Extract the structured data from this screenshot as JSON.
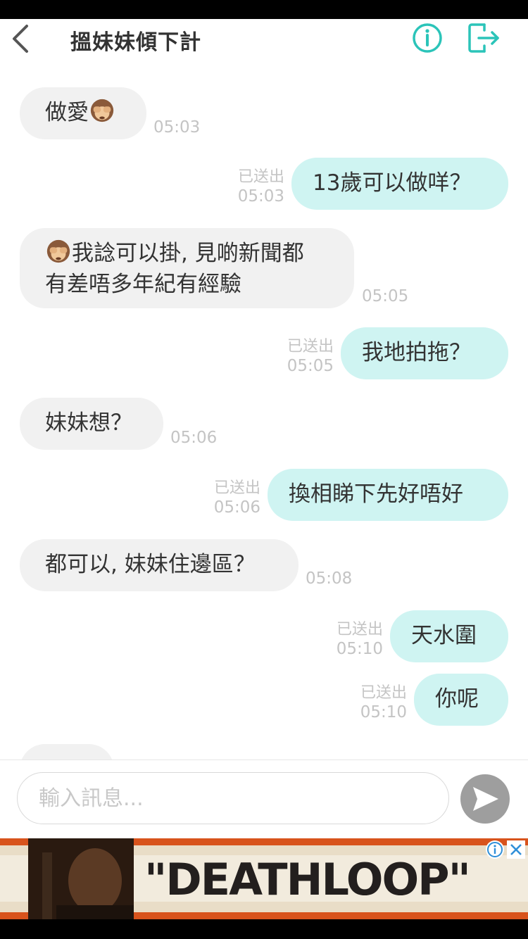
{
  "header": {
    "title": "搵妹妹傾下計",
    "back_icon": "chevron-left-icon",
    "info_icon": "info-icon",
    "exit_icon": "exit-icon",
    "accent_color": "#2bc4b9"
  },
  "messages": [
    {
      "dir": "in",
      "text": "做愛",
      "emoji": "see-no-evil-monkey",
      "time": "05:03"
    },
    {
      "dir": "out",
      "text": "13歲可以做咩？",
      "status": "已送出",
      "time": "05:03"
    },
    {
      "dir": "in",
      "line1": "我諗可以掛, 見啲新聞都",
      "line2": "有差唔多年紀有經驗",
      "emoji": "see-no-evil-monkey",
      "time": "05:05"
    },
    {
      "dir": "out",
      "text": "我地拍拖？",
      "status": "已送出",
      "time": "05:05"
    },
    {
      "dir": "in",
      "text": "妹妹想？",
      "time": "05:06"
    },
    {
      "dir": "out",
      "text": "換相睇下先好唔好",
      "status": "已送出",
      "time": "05:06"
    },
    {
      "dir": "in",
      "text": "都可以, 妹妹住邊區？",
      "time": "05:08"
    },
    {
      "dir": "out",
      "text": "天水圍",
      "status": "已送出",
      "time": "05:10"
    },
    {
      "dir": "out",
      "text": "你呢",
      "status": "已送出",
      "time": "05:10"
    },
    {
      "dir": "in",
      "text": "",
      "time": ""
    }
  ],
  "composer": {
    "placeholder": "輸入訊息...",
    "send_icon": "send-icon"
  },
  "ad": {
    "text": "\"DEATHLOOP\"",
    "info_icon": "ad-info-icon",
    "close_icon": "close-icon"
  },
  "colors": {
    "incoming_bubble": "#f1f1f1",
    "outgoing_bubble": "#cff4f2",
    "meta_text": "#c4c4c4"
  }
}
